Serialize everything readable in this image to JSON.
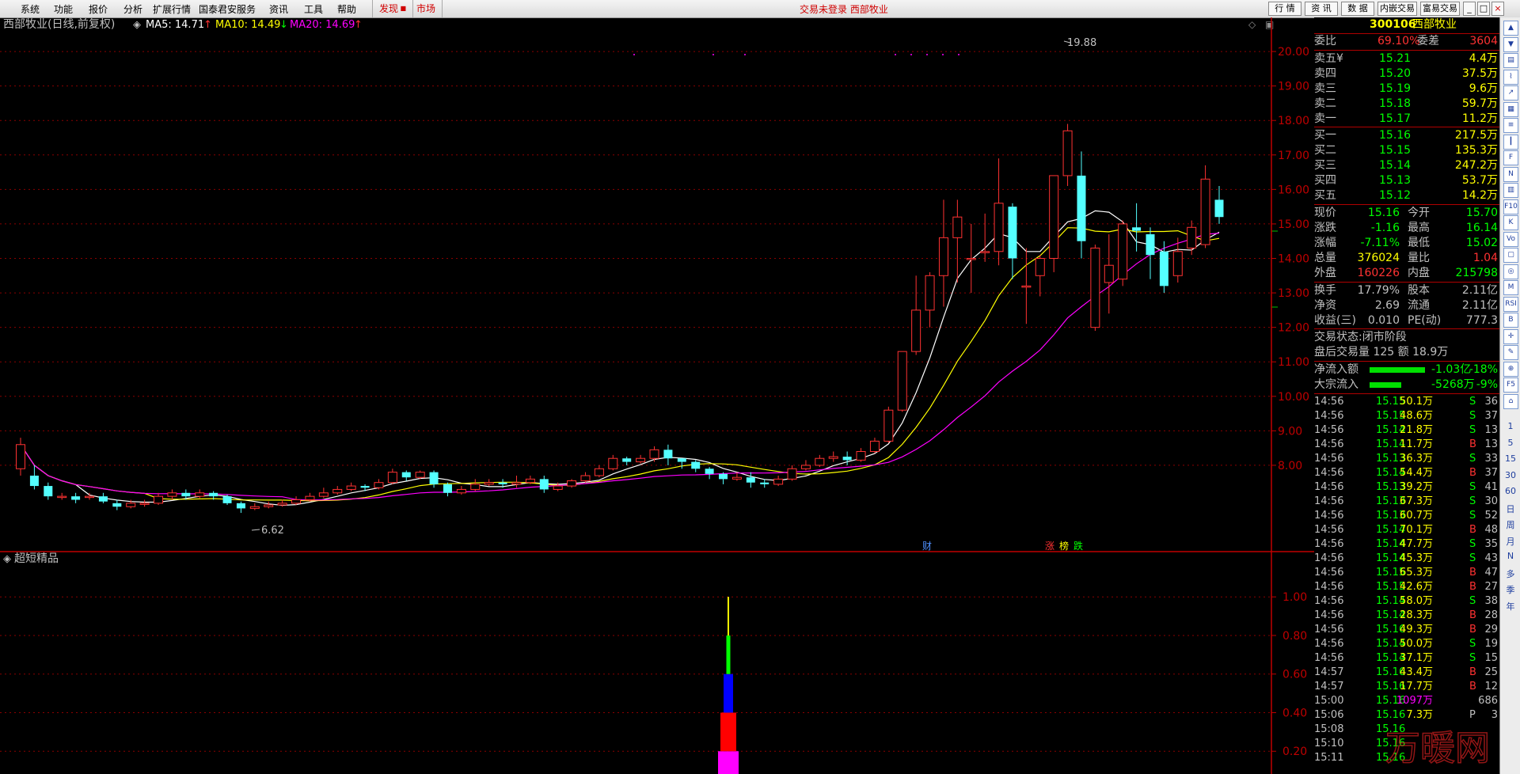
{
  "menubar": {
    "items": [
      "系统",
      "功能",
      "报价",
      "分析",
      "扩展行情",
      "国泰君安服务",
      "资讯",
      "工具",
      "帮助"
    ],
    "faxian": "发现",
    "shichang": "市场",
    "notice": "交易未登录  西部牧业",
    "right_buttons": [
      "行 情",
      "资 讯",
      "数 据",
      "内嵌交易",
      "富易交易"
    ]
  },
  "chart_header": {
    "title": "西部牧业(日线,前复权)",
    "ma5": "MA5: 14.71",
    "ma10": "MA10: 14.49",
    "ma20": "MA20: 14.69",
    "ma5_arrow": "↑",
    "ma10_arrow": "↓",
    "ma20_arrow": "↑"
  },
  "indicator_header": {
    "title": "超短精品"
  },
  "annotations": {
    "high_label": "19.88",
    "low_label": "6.62",
    "cai": "财",
    "zhang": "涨",
    "bang": "榜",
    "die": "跌"
  },
  "colors": {
    "up": "#ff3232",
    "down": "#54ffff",
    "ma5": "#ffffff",
    "ma10": "#ffff00",
    "ma20": "#ff00ff",
    "grid": "#8b0000",
    "axis": "#c00000",
    "green": "#00ff00",
    "blue": "#0000ff",
    "red": "#ff0000",
    "magenta": "#ff00ff"
  },
  "chart_data": [
    {
      "type": "candlestick",
      "title": "西部牧业(日线,前复权)",
      "ylim": [
        6.3,
        20.3
      ],
      "yticks": [
        "20.00",
        "19.00",
        "18.00",
        "17.00",
        "16.00",
        "15.00",
        "14.00",
        "13.00",
        "12.00",
        "11.00",
        "10.00",
        "9.00",
        "8.00"
      ],
      "candles": [
        [
          7.9,
          8.6,
          7.7,
          8.8
        ],
        [
          7.7,
          7.4,
          7.3,
          8.0
        ],
        [
          7.4,
          7.1,
          7.0,
          7.5
        ],
        [
          7.1,
          7.1,
          7.0,
          7.2
        ],
        [
          7.1,
          7.0,
          6.9,
          7.2
        ],
        [
          7.1,
          7.1,
          7.0,
          7.2
        ],
        [
          7.1,
          6.95,
          6.9,
          7.2
        ],
        [
          6.9,
          6.8,
          6.7,
          7.0
        ],
        [
          6.8,
          6.9,
          6.75,
          7.0
        ],
        [
          6.9,
          6.9,
          6.8,
          7.0
        ],
        [
          6.9,
          7.1,
          6.85,
          7.2
        ],
        [
          7.1,
          7.2,
          7.0,
          7.3
        ],
        [
          7.2,
          7.1,
          7.0,
          7.3
        ],
        [
          7.1,
          7.2,
          7.05,
          7.3
        ],
        [
          7.2,
          7.1,
          7.0,
          7.25
        ],
        [
          7.1,
          6.9,
          6.85,
          7.15
        ],
        [
          6.9,
          6.75,
          6.62,
          6.95
        ],
        [
          6.75,
          6.8,
          6.7,
          6.9
        ],
        [
          6.8,
          6.85,
          6.75,
          6.95
        ],
        [
          6.85,
          6.9,
          6.8,
          7.0
        ],
        [
          6.9,
          7.0,
          6.85,
          7.1
        ],
        [
          7.0,
          7.1,
          6.95,
          7.2
        ],
        [
          7.1,
          7.2,
          7.05,
          7.35
        ],
        [
          7.2,
          7.3,
          7.15,
          7.4
        ],
        [
          7.3,
          7.4,
          7.25,
          7.5
        ],
        [
          7.4,
          7.35,
          7.25,
          7.45
        ],
        [
          7.35,
          7.5,
          7.3,
          7.6
        ],
        [
          7.5,
          7.8,
          7.45,
          7.9
        ],
        [
          7.8,
          7.65,
          7.55,
          7.85
        ],
        [
          7.65,
          7.8,
          7.6,
          7.85
        ],
        [
          7.8,
          7.45,
          7.35,
          7.85
        ],
        [
          7.45,
          7.2,
          7.1,
          7.5
        ],
        [
          7.2,
          7.3,
          7.15,
          7.4
        ],
        [
          7.3,
          7.45,
          7.25,
          7.6
        ],
        [
          7.45,
          7.5,
          7.4,
          7.6
        ],
        [
          7.5,
          7.45,
          7.35,
          7.6
        ],
        [
          7.45,
          7.5,
          7.35,
          7.7
        ],
        [
          7.5,
          7.6,
          7.45,
          7.7
        ],
        [
          7.6,
          7.3,
          7.2,
          7.7
        ],
        [
          7.3,
          7.4,
          7.25,
          7.5
        ],
        [
          7.4,
          7.55,
          7.35,
          7.6
        ],
        [
          7.55,
          7.7,
          7.5,
          7.8
        ],
        [
          7.7,
          7.9,
          7.65,
          8.0
        ],
        [
          7.9,
          8.2,
          7.85,
          8.3
        ],
        [
          8.2,
          8.1,
          8.0,
          8.25
        ],
        [
          8.1,
          8.2,
          8.05,
          8.3
        ],
        [
          8.2,
          8.45,
          8.1,
          8.55
        ],
        [
          8.45,
          8.2,
          8.0,
          8.6
        ],
        [
          8.2,
          8.1,
          7.9,
          8.2
        ],
        [
          8.1,
          7.9,
          7.8,
          8.15
        ],
        [
          7.9,
          7.75,
          7.6,
          7.95
        ],
        [
          7.75,
          7.6,
          7.45,
          7.8
        ],
        [
          7.6,
          7.65,
          7.55,
          7.8
        ],
        [
          7.65,
          7.5,
          7.35,
          7.8
        ],
        [
          7.5,
          7.45,
          7.35,
          7.6
        ],
        [
          7.45,
          7.6,
          7.4,
          7.7
        ],
        [
          7.6,
          7.9,
          7.55,
          8.0
        ],
        [
          7.9,
          8.0,
          7.85,
          8.15
        ],
        [
          8.0,
          8.2,
          7.95,
          8.3
        ],
        [
          8.2,
          8.25,
          8.1,
          8.4
        ],
        [
          8.25,
          8.15,
          8.0,
          8.4
        ],
        [
          8.15,
          8.4,
          8.1,
          8.5
        ],
        [
          8.4,
          8.7,
          8.35,
          8.8
        ],
        [
          8.7,
          9.6,
          8.65,
          9.7
        ],
        [
          9.6,
          11.3,
          9.55,
          11.3
        ],
        [
          11.3,
          12.5,
          11.2,
          13.5
        ],
        [
          12.5,
          13.5,
          12.0,
          13.6
        ],
        [
          13.5,
          14.6,
          12.6,
          15.7
        ],
        [
          14.6,
          15.2,
          13.3,
          15.7
        ],
        [
          14.0,
          14.0,
          13.0,
          15.0
        ],
        [
          14.2,
          14.2,
          13.9,
          15.3
        ],
        [
          14.2,
          15.6,
          13.8,
          16.9
        ],
        [
          15.5,
          14.0,
          13.4,
          15.6
        ],
        [
          13.2,
          13.2,
          12.1,
          14.3
        ],
        [
          13.5,
          14.0,
          12.9,
          14.1
        ],
        [
          14.0,
          16.4,
          13.6,
          16.4
        ],
        [
          16.4,
          17.7,
          16.1,
          17.9
        ],
        [
          16.4,
          14.5,
          14.0,
          17.1
        ],
        [
          12.0,
          14.3,
          11.9,
          14.4
        ],
        [
          13.3,
          13.8,
          12.4,
          14.7
        ],
        [
          13.4,
          15.0,
          13.2,
          15.1
        ],
        [
          14.9,
          14.8,
          14.2,
          15.6
        ],
        [
          14.7,
          14.1,
          13.4,
          14.9
        ],
        [
          14.2,
          13.2,
          13.0,
          14.5
        ],
        [
          13.5,
          14.2,
          13.3,
          14.6
        ],
        [
          14.3,
          14.9,
          14.1,
          15.1
        ],
        [
          14.4,
          16.3,
          14.3,
          16.7
        ],
        [
          15.7,
          15.2,
          15.0,
          16.1
        ]
      ],
      "ma5_last": 14.71,
      "ma10_last": 14.49,
      "ma20_last": 14.69
    },
    {
      "type": "bar",
      "title": "超短精品",
      "ylim": [
        0,
        1.05
      ],
      "yticks": [
        "1.00",
        "0.80",
        "0.60",
        "0.40",
        "0.20"
      ],
      "segments": [
        {
          "color": "magenta",
          "from": 0.0,
          "to": 0.2
        },
        {
          "color": "red",
          "from": 0.2,
          "to": 0.4
        },
        {
          "color": "blue",
          "from": 0.4,
          "to": 0.6
        },
        {
          "color": "green",
          "from": 0.6,
          "to": 0.8
        },
        {
          "color": "yellow",
          "from": 0.8,
          "to": 1.0
        }
      ]
    }
  ],
  "quote": {
    "code": "300106",
    "name": "西部牧业",
    "weibi_label": "委比",
    "weibi": "69.10%",
    "weicha_label": "委差",
    "weicha": "3604",
    "sell": [
      {
        "label": "卖五",
        "price": "15.21",
        "vol": "4.4万",
        "extra": "¥"
      },
      {
        "label": "卖四",
        "price": "15.20",
        "vol": "37.5万",
        "extra": ""
      },
      {
        "label": "卖三",
        "price": "15.19",
        "vol": "9.6万",
        "extra": ""
      },
      {
        "label": "卖二",
        "price": "15.18",
        "vol": "59.7万",
        "extra": ""
      },
      {
        "label": "卖一",
        "price": "15.17",
        "vol": "11.2万",
        "extra": ""
      }
    ],
    "buy": [
      {
        "label": "买一",
        "price": "15.16",
        "vol": "217.5万"
      },
      {
        "label": "买二",
        "price": "15.15",
        "vol": "135.3万"
      },
      {
        "label": "买三",
        "price": "15.14",
        "vol": "247.2万"
      },
      {
        "label": "买四",
        "price": "15.13",
        "vol": "53.7万"
      },
      {
        "label": "买五",
        "price": "15.12",
        "vol": "14.2万"
      }
    ],
    "stats": [
      {
        "l1": "现价",
        "v1": "15.16",
        "l2": "今开",
        "v2": "15.70",
        "c1": "#00ff00",
        "c2": "#00ff00"
      },
      {
        "l1": "涨跌",
        "v1": "-1.16",
        "l2": "最高",
        "v2": "16.14",
        "c1": "#00ff00",
        "c2": "#00ff00"
      },
      {
        "l1": "涨幅",
        "v1": "-7.11%",
        "l2": "最低",
        "v2": "15.02",
        "c1": "#00ff00",
        "c2": "#00ff00"
      },
      {
        "l1": "总量",
        "v1": "376024",
        "l2": "量比",
        "v2": "1.04",
        "c1": "#ffff00",
        "c2": "#ff3232"
      },
      {
        "l1": "外盘",
        "v1": "160226",
        "l2": "内盘",
        "v2": "215798",
        "c1": "#ff3232",
        "c2": "#00ff00"
      }
    ],
    "stats2": [
      {
        "l1": "换手",
        "v1": "17.79%",
        "l2": "股本",
        "v2": "2.11亿"
      },
      {
        "l1": "净资",
        "v1": "2.69",
        "l2": "流通",
        "v2": "2.11亿"
      },
      {
        "l1": "收益(三)",
        "v1": "0.010",
        "l2": "PE(动)",
        "v2": "777.3"
      }
    ],
    "trade_status": "交易状态:闭市阶段",
    "after_hours": "盘后交易量 125 额 18.9万",
    "netflow_label": "净流入额",
    "netflow": "-1.03亿",
    "netflow_pct": "-18%",
    "bigflow_label": "大宗流入",
    "bigflow": "-5268万",
    "bigflow_pct": "-9%",
    "ticks": [
      [
        "14:56",
        "15.15",
        "50.1万",
        "S",
        "36"
      ],
      [
        "14:56",
        "15.15",
        "48.6万",
        "S",
        "37"
      ],
      [
        "14:56",
        "15.14",
        "21.8万",
        "S",
        "13"
      ],
      [
        "14:56",
        "15.14",
        "11.7万",
        "B",
        "13"
      ],
      [
        "14:56",
        "15.13",
        "36.3万",
        "S",
        "33"
      ],
      [
        "14:56",
        "15.14",
        "54.4万",
        "B",
        "37"
      ],
      [
        "14:56",
        "15.13",
        "39.2万",
        "S",
        "41"
      ],
      [
        "14:56",
        "15.13",
        "67.3万",
        "S",
        "30"
      ],
      [
        "14:56",
        "15.13",
        "60.7万",
        "S",
        "52"
      ],
      [
        "14:56",
        "15.14",
        "70.1万",
        "B",
        "48"
      ],
      [
        "14:56",
        "15.14",
        "47.7万",
        "S",
        "35"
      ],
      [
        "14:56",
        "15.14",
        "45.3万",
        "S",
        "43"
      ],
      [
        "14:56",
        "15.15",
        "65.3万",
        "B",
        "47"
      ],
      [
        "14:56",
        "15.15",
        "42.6万",
        "B",
        "27"
      ],
      [
        "14:56",
        "15.14",
        "58.0万",
        "S",
        "38"
      ],
      [
        "14:56",
        "15.14",
        "28.3万",
        "B",
        "28"
      ],
      [
        "14:56",
        "15.16",
        "49.3万",
        "B",
        "29"
      ],
      [
        "14:56",
        "15.14",
        "50.0万",
        "S",
        "19"
      ],
      [
        "14:56",
        "15.14",
        "37.1万",
        "S",
        "15"
      ],
      [
        "14:57",
        "15.16",
        "43.4万",
        "B",
        "25"
      ],
      [
        "14:57",
        "15.16",
        "17.7万",
        "B",
        "12"
      ],
      [
        "15:00",
        "15.16",
        "1097万",
        "",
        "686"
      ],
      [
        "15:06",
        "15.16",
        "7.3万",
        "P",
        "3"
      ],
      [
        "15:08",
        "15.16",
        "",
        "",
        ""
      ],
      [
        "15:10",
        "15.16",
        "",
        "",
        ""
      ],
      [
        "15:11",
        "15.16",
        "",
        "",
        ""
      ]
    ]
  },
  "toolbar": {
    "labels": [
      "1",
      "5",
      "15",
      "30",
      "60",
      "日",
      "周",
      "月",
      "N",
      "多",
      "季",
      "年"
    ]
  }
}
